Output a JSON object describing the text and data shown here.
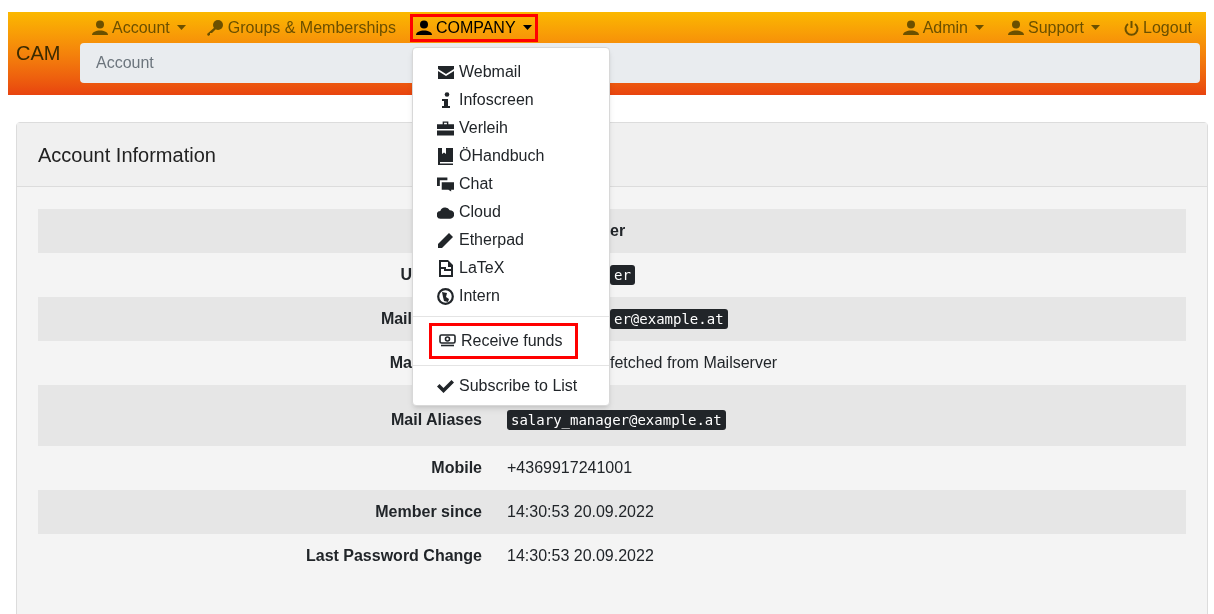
{
  "brand": "CAM",
  "nav_left": [
    {
      "label": "Account",
      "has_menu": true,
      "highlighted": false
    },
    {
      "label": "Groups & Memberships",
      "has_menu": false,
      "highlighted": false
    },
    {
      "label": "COMPANY",
      "has_menu": true,
      "highlighted": true
    }
  ],
  "nav_right": [
    {
      "label": "Admin",
      "has_menu": true,
      "highlighted": false
    },
    {
      "label": "Support",
      "has_menu": true,
      "highlighted": false
    },
    {
      "label": "Logout",
      "has_menu": false,
      "highlighted": false
    }
  ],
  "breadcrumb": [
    "Account"
  ],
  "dropdown": {
    "groups": [
      [
        {
          "label": "Webmail",
          "highlighted": false
        },
        {
          "label": "Infoscreen",
          "highlighted": false
        },
        {
          "label": "Verleih",
          "highlighted": false
        },
        {
          "label": "ÖHandbuch",
          "highlighted": false
        },
        {
          "label": "Chat",
          "highlighted": false
        },
        {
          "label": "Cloud",
          "highlighted": false
        },
        {
          "label": "Etherpad",
          "highlighted": false
        },
        {
          "label": "LaTeX",
          "highlighted": false
        },
        {
          "label": "Intern",
          "highlighted": false
        }
      ],
      [
        {
          "label": "Receive funds",
          "highlighted": true
        }
      ],
      [
        {
          "label": "Subscribe to List",
          "highlighted": false
        }
      ]
    ]
  },
  "card": {
    "title": "Account Information",
    "rows": [
      {
        "kind": "covered",
        "value": {
          "text": "er",
          "kind": "bold"
        }
      },
      {
        "kind": "covered",
        "label": "U",
        "value": {
          "text": "er",
          "kind": "code"
        }
      },
      {
        "kind": "covered",
        "label": "Mail",
        "value": {
          "text": "er@example.at",
          "kind": "code"
        }
      },
      {
        "kind": "covered",
        "label": "Ma",
        "value": {
          "text": "fetched from Mailserver",
          "kind": "text"
        }
      },
      {
        "kind": "list",
        "label": "Mail Aliases",
        "value": {
          "text": "salary_manager@example.at",
          "kind": "code"
        }
      },
      {
        "kind": "plain",
        "label": "Mobile",
        "value": {
          "text": "+4369917241001",
          "kind": "text"
        }
      },
      {
        "kind": "plain",
        "label": "Member since",
        "value": {
          "text": "14:30:53 20.09.2022",
          "kind": "text"
        }
      },
      {
        "kind": "plain",
        "label": "Last Password Change",
        "value": {
          "text": "14:30:53 20.09.2022",
          "kind": "text"
        }
      }
    ]
  }
}
